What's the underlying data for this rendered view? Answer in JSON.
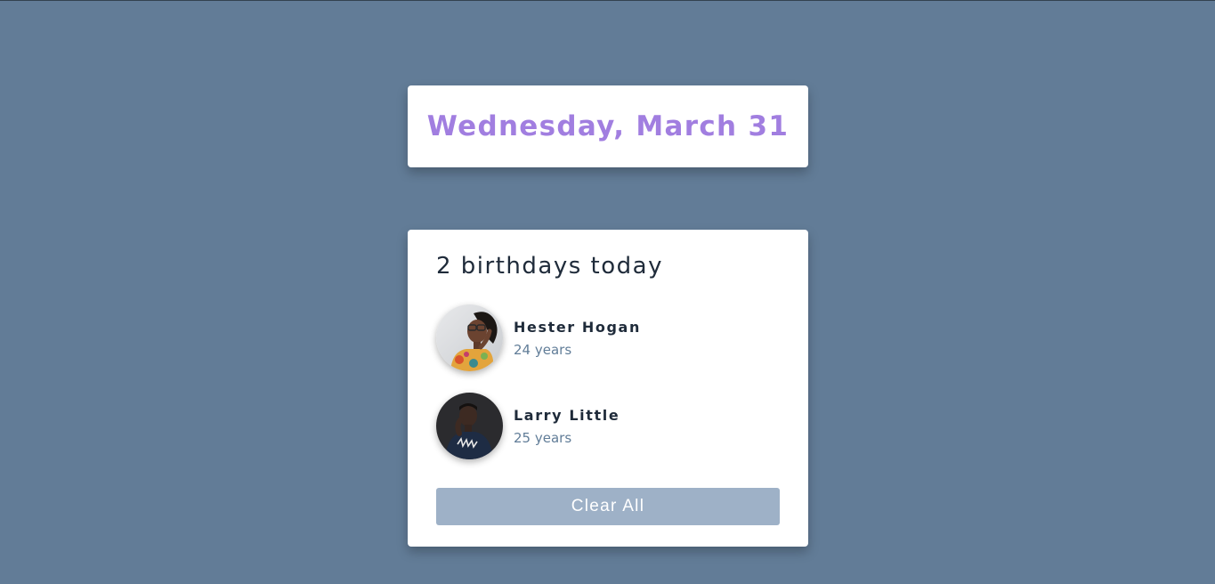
{
  "date_card": {
    "title": "Wednesday, March 31"
  },
  "birthdays": {
    "heading": "2 birthdays today",
    "people": [
      {
        "name": "Hester Hogan",
        "age": "24 years"
      },
      {
        "name": "Larry Little",
        "age": "25 years"
      }
    ],
    "clear_label": "Clear All"
  },
  "colors": {
    "background": "#627c97",
    "date_accent": "#a17ee0",
    "button": "#9eb1c7"
  }
}
